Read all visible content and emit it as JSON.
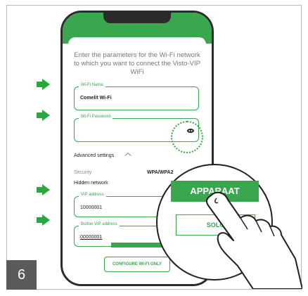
{
  "intro_text": "Enter the parameters for the Wi-Fi network to which you want to connect the Visto-VIP WiFi",
  "wifi_name": {
    "label": "Wi-Fi Name",
    "value": "Comelit Wi-Fi"
  },
  "wifi_password": {
    "label": "Wi-Fi Password",
    "value": ""
  },
  "advanced_settings_label": "Advanced settings",
  "security_label": "Security",
  "security_value": "WPA/WPA2",
  "hidden_network_label": "Hidden network",
  "vip_address": {
    "label": "VIP address",
    "value": "10000001"
  },
  "button_vip_address": {
    "label": "Button VIP address",
    "value": "00000001"
  },
  "configure_button_label": "CONFIGURE WI-FI ONLY",
  "zoom_primary_button_label": "APPARAAT",
  "zoom_secondary_button_label": "SOLO",
  "step_number": "6",
  "accent_color": "#3aa64d"
}
